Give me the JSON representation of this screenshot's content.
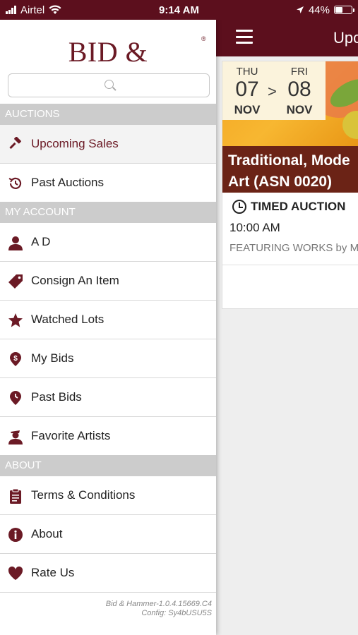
{
  "status_bar": {
    "carrier": "Airtel",
    "time": "9:14 AM",
    "battery": "44%",
    "battery_level": 0.44
  },
  "drawer": {
    "brand": "BID & HAMMER",
    "brand_mark": "®",
    "search": {
      "placeholder": ""
    },
    "sections": [
      {
        "title": "AUCTIONS",
        "items": [
          {
            "label": "Upcoming Sales",
            "icon": "gavel-icon",
            "active": true
          },
          {
            "label": "Past Auctions",
            "icon": "history-icon",
            "active": false
          }
        ]
      },
      {
        "title": "MY ACCOUNT",
        "items": [
          {
            "label": "A D",
            "icon": "user-icon"
          },
          {
            "label": "Consign An Item",
            "icon": "tag-icon"
          },
          {
            "label": "Watched Lots",
            "icon": "star-icon"
          },
          {
            "label": "My Bids",
            "icon": "dollar-pin-icon"
          },
          {
            "label": "Past Bids",
            "icon": "clock-pin-icon"
          },
          {
            "label": "Favorite Artists",
            "icon": "artist-icon"
          }
        ]
      },
      {
        "title": "ABOUT",
        "items": [
          {
            "label": "Terms & Conditions",
            "icon": "clipboard-icon"
          },
          {
            "label": "About",
            "icon": "info-icon"
          },
          {
            "label": "Rate Us",
            "icon": "heart-icon"
          }
        ]
      }
    ],
    "version_line1": "Bid & Hammer-1.0.4.15669.C4",
    "version_line2": "Config: Sy4bUSU5S"
  },
  "main": {
    "header_title": "Upc",
    "card": {
      "start_dow": "THU",
      "start_day": "07",
      "start_month": "NOV",
      "arrow": ">",
      "end_dow": "FRI",
      "end_day": "08",
      "end_month": "NOV",
      "title_line1": "Traditional, Mode",
      "title_line2": "Art (ASN 0020)",
      "type": "TIMED AUCTION",
      "time": "10:00 AM",
      "featuring": "FEATURING WORKS by M"
    }
  },
  "colors": {
    "brand": "#5c0f1d",
    "accent": "#6b1a25",
    "section_header": "#cccccc"
  }
}
